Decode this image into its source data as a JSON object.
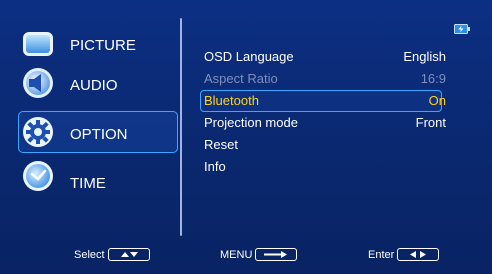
{
  "left_menu": {
    "items": [
      {
        "label": "PICTURE",
        "icon": "picture-icon"
      },
      {
        "label": "AUDIO",
        "icon": "audio-icon"
      },
      {
        "label": "OPTION",
        "icon": "option-gear-icon",
        "selected": true
      },
      {
        "label": "TIME",
        "icon": "time-clock-icon"
      }
    ]
  },
  "status": {
    "icon": "battery-charging-icon"
  },
  "settings": {
    "rows": [
      {
        "name": "OSD Language",
        "value": "English",
        "state": "normal"
      },
      {
        "name": "Aspect Ratio",
        "value": "16:9",
        "state": "disabled"
      },
      {
        "name": "Bluetooth",
        "value": "On",
        "state": "selected"
      },
      {
        "name": "Projection mode",
        "value": "Front",
        "state": "normal"
      },
      {
        "name": "Reset",
        "value": "",
        "state": "normal"
      },
      {
        "name": "Info",
        "value": "",
        "state": "normal"
      }
    ]
  },
  "footer": {
    "select_label": "Select",
    "menu_label": "MENU",
    "enter_label": "Enter"
  },
  "colors": {
    "background": "#0b2a7a",
    "highlight_border": "#3aa8ff",
    "selected_text": "#ffd21a",
    "disabled_text": "#7e8fbf"
  }
}
